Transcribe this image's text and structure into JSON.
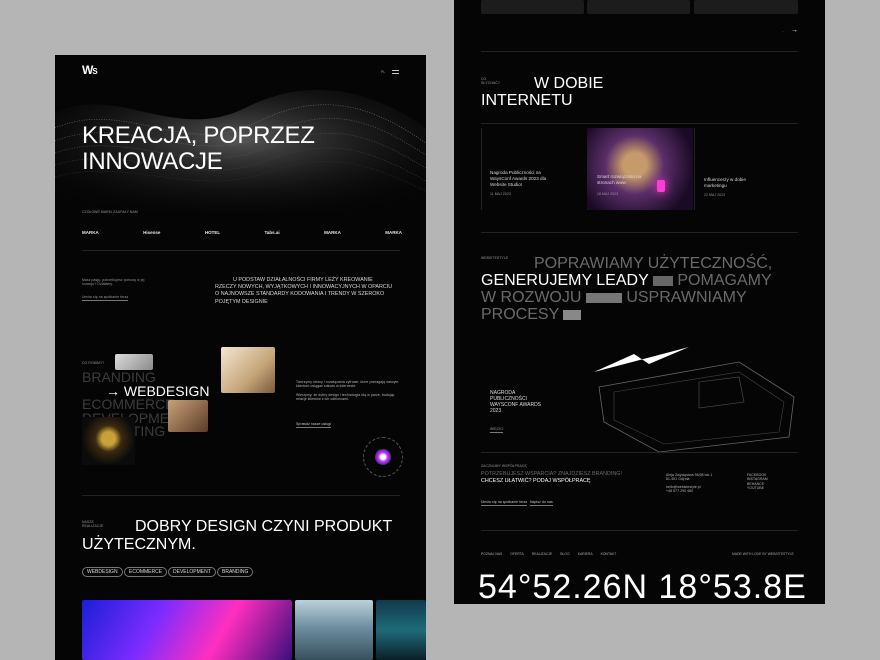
{
  "left": {
    "lang": "PL",
    "hero_title_1": "KREACJA, POPRZEZ",
    "hero_title_2": "INNOWACJE",
    "trusted_label": "CZOŁOWE MARKI ZAUFAŁY NAM",
    "brands": [
      "MARKA",
      "Hisense",
      "HOTEL",
      "Tabs.ai",
      "MARKA",
      "MARKA"
    ],
    "intro_small_1": "Masz pasję, potrzebujesz pomocy w jej",
    "intro_small_2": "rozwoju? Działamy.",
    "intro_link": "Umów się na spotkanie teraz",
    "intro_lead": "U PODSTAW DZIAŁALNOŚCI FIRMY LEŻY KREOWANIE RZECZY NOWYCH, WYJĄTKOWYCH I INNOWACYJNYCH W OPARCIU O NAJNOWSZE STANDARDY KODOWANIA I TRENDY W SZEROKO POJĘTYM DESIGNIE",
    "services_label": "CO ROBIMY?",
    "services": [
      "BRANDING",
      "WEBDESIGN",
      "ECOMMERCE",
      "DEVELOPMENT",
      "MARKETING",
      "WIĘCEJ"
    ],
    "services_text_1": "Tworzymy strony i rozwiązania cyfrowe, które pomagają naszym klientom osiągać sukces w internecie.",
    "services_text_2": "Wierzymy, że dobry design i technologia idą w parze, budując relacje klientów z ich odbiorcami.",
    "services_link": "Sprawdź nasze usługi",
    "badge_text": "SCROLL • DOWN • SCROLL •",
    "work_label_1": "NASZE",
    "work_label_2": "REALIZACJE",
    "work_title_1": "DOBRY DESIGN CZYNI PRODUKT",
    "work_title_2": "UŻYTECZNYM.",
    "filters": [
      "WEBDESIGN",
      "ECOMMERCE",
      "DEVELOPMENT",
      "BRANDING"
    ]
  },
  "right": {
    "section_label_1": "CO",
    "section_label_2": "SŁYCHAĆ?",
    "news_title_1": "W DOBIE",
    "news_title_2": "INTERNETU",
    "news": [
      {
        "title": "Nagroda Publiczności na WaysConf Awards 2023 dla Website Studio!",
        "date": "11 MAJ 2023"
      },
      {
        "title": "Smart rozwiązania na stronach www",
        "date": "18 MAJ 2023"
      },
      {
        "title": "Influencerzy w dobie marketingu",
        "date": "22 MAJ 2023"
      }
    ],
    "webstyle_label": "WEBSITESTYLE",
    "tagline": [
      "POPRAWIAMY UŻYTECZNOŚĆ,",
      "GENERUJEMY LEADY",
      "POMAGAMY",
      "W ROZWOJU",
      "USPRAWNIAMY",
      "PROCESY"
    ],
    "award_1": "NAGRODA",
    "award_2": "PUBLICZNOŚCI",
    "award_3": "WAYSCONF AWARDS",
    "award_4": "2023",
    "award_link": "WIĘCEJ",
    "contact_label": "ZACZNIJMY WSPÓŁPRACĘ",
    "contact_line_1": "POTRZEBUJESZ WSPARCIA? ZNAJDZIESZ BRANDING!",
    "contact_line_2": "CHCESZ UŁATWIĆ? PODAJ WSPÓŁPRACĘ",
    "address": [
      "Aleja Zwycięstwa 96/98 lok.1",
      "81-451 Gdynia"
    ],
    "email_phone": [
      "hello@websitestyle.pl",
      "+48 577 290 480"
    ],
    "socials": [
      "FACEBOOK",
      "INSTAGRAM",
      "BEHANCE",
      "YOUTUBE"
    ],
    "cta_1": "Umów się na spotkanie teraz",
    "cta_2": "Napisz do nas",
    "footer_nav": [
      "POZNAJ NAS",
      "OFERTA",
      "REALIZACJE",
      "BLOG",
      "KARIERA",
      "KONTAKT"
    ],
    "footer_right": "MADE WITH LOVE BY WEBSITESTYLE",
    "coords": "54°52.26N 18°53.8E"
  },
  "colors": {
    "panel_bg": "#050505",
    "page_bg": "#b5b5b5",
    "accent_violet": "#7a3cff",
    "accent_pink": "#ff3cb4"
  }
}
